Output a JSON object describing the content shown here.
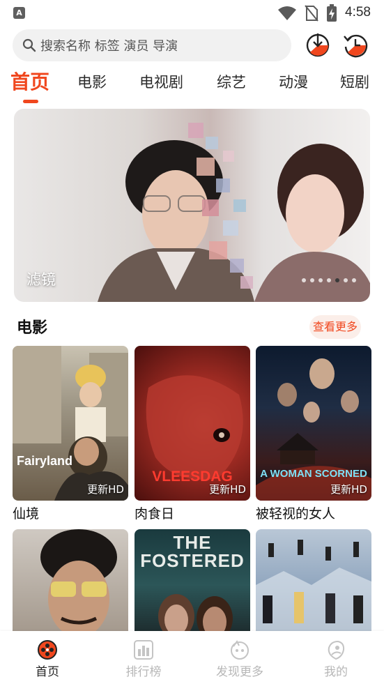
{
  "status_bar": {
    "app_icon_letter": "A",
    "time": "4:58"
  },
  "search": {
    "placeholder": "搜索名称 标签 演员 导演"
  },
  "top_icons": {
    "download": "download-icon",
    "history": "history-icon"
  },
  "tabs": [
    {
      "label": "首页",
      "active": true
    },
    {
      "label": "电影",
      "active": false
    },
    {
      "label": "电视剧",
      "active": false
    },
    {
      "label": "综艺",
      "active": false
    },
    {
      "label": "动漫",
      "active": false
    },
    {
      "label": "短剧",
      "active": false
    }
  ],
  "banner": {
    "caption": "滤镜",
    "dot_count": 7,
    "active_dot": 4
  },
  "section": {
    "title": "电影",
    "more_label": "查看更多"
  },
  "movies": [
    {
      "title": "仙境",
      "badge": "更新HD",
      "poster_text": "Fairyland"
    },
    {
      "title": "肉食日",
      "badge": "更新HD",
      "poster_text": "VLEESDAG"
    },
    {
      "title": "被轻视的女人",
      "badge": "更新HD",
      "poster_text": "A WOMAN SCORNED"
    },
    {
      "title": "",
      "badge": "",
      "poster_text": ""
    },
    {
      "title": "",
      "badge": "",
      "poster_text": "THE FOSTERED"
    },
    {
      "title": "",
      "badge": "",
      "poster_text": ""
    }
  ],
  "bottom_nav": [
    {
      "label": "首页",
      "icon": "home-icon",
      "active": true
    },
    {
      "label": "排行榜",
      "icon": "ranking-icon",
      "active": false
    },
    {
      "label": "发现更多",
      "icon": "discover-icon",
      "active": false
    },
    {
      "label": "我的",
      "icon": "profile-icon",
      "active": false
    }
  ],
  "colors": {
    "accent": "#f0471e",
    "inactive": "#b7b7b7"
  }
}
